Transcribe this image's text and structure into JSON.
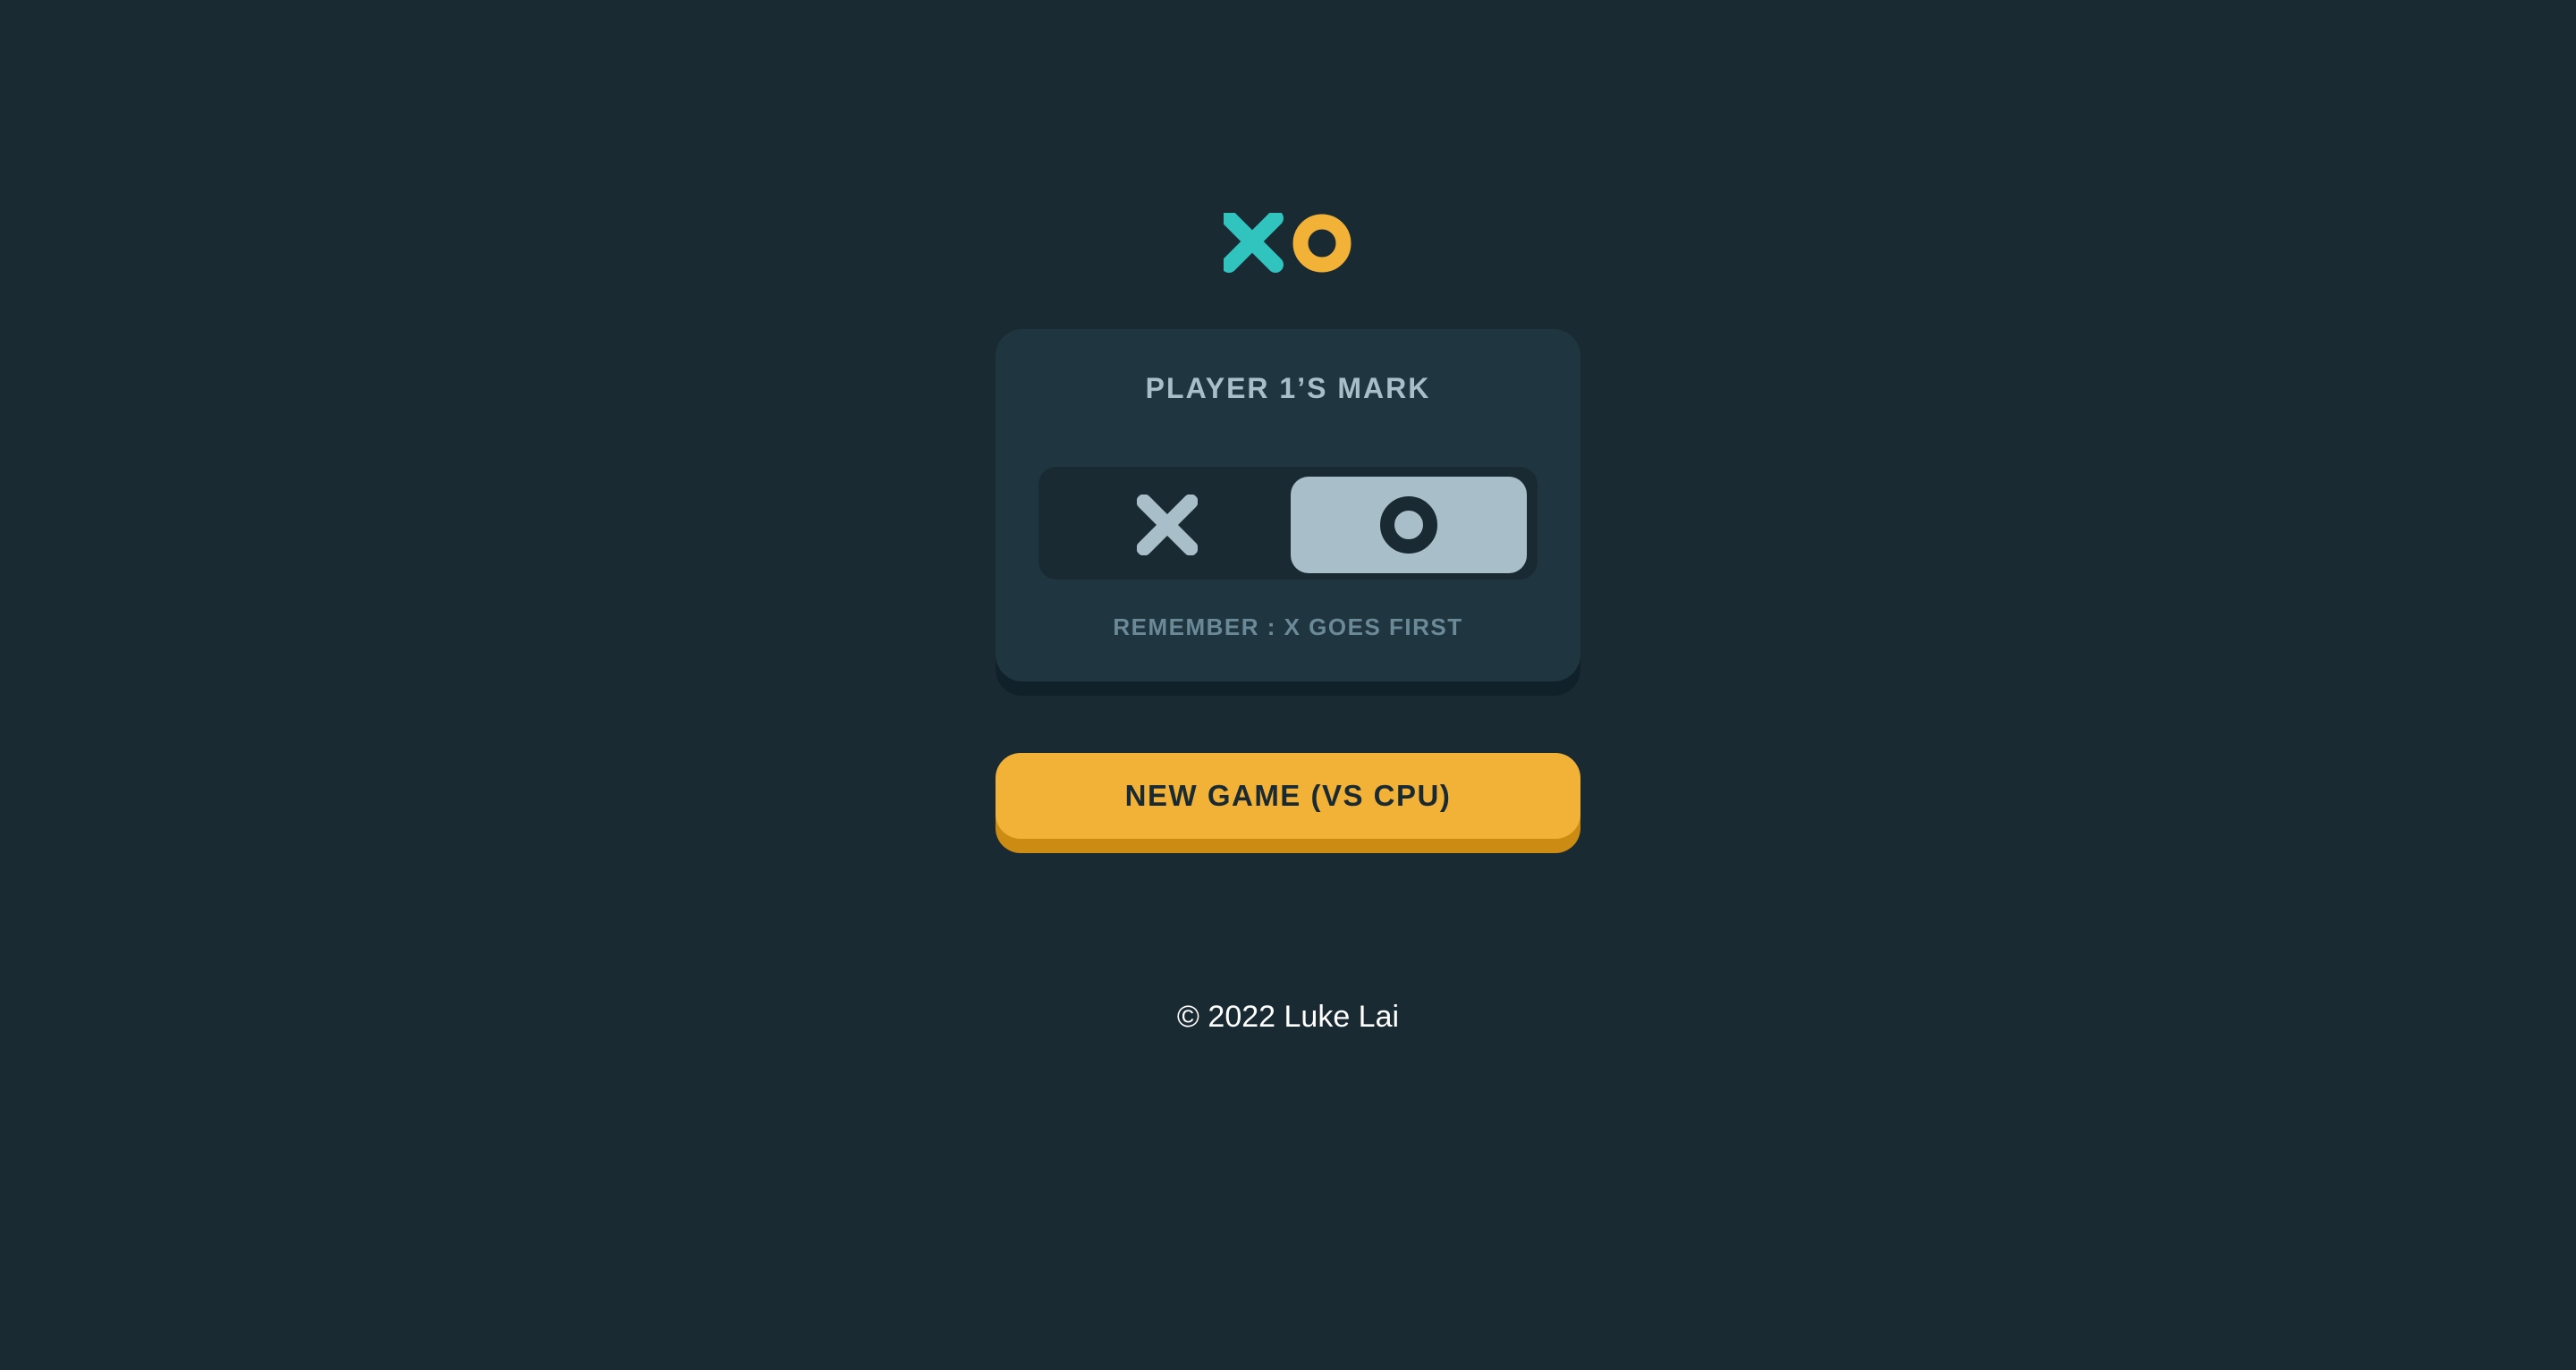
{
  "logo": {
    "icons": [
      "x-mark-icon",
      "o-mark-icon"
    ],
    "x_color": "#31c3bd",
    "o_color": "#f2b137"
  },
  "mark_picker": {
    "title": "PLAYER 1’S MARK",
    "options": [
      {
        "label": "X",
        "icon": "x-mark-icon",
        "selected": false
      },
      {
        "label": "O",
        "icon": "o-mark-icon",
        "selected": true
      }
    ],
    "note": "REMEMBER : X GOES FIRST"
  },
  "actions": {
    "new_game_label": "NEW GAME (VS CPU)"
  },
  "footer": {
    "copyright": "© 2022 Luke Lai"
  },
  "colors": {
    "background": "#1a2a33",
    "card": "#1f3641",
    "silver": "#a8bfc9",
    "yellow": "#f2b137",
    "teal": "#31c3bd"
  }
}
